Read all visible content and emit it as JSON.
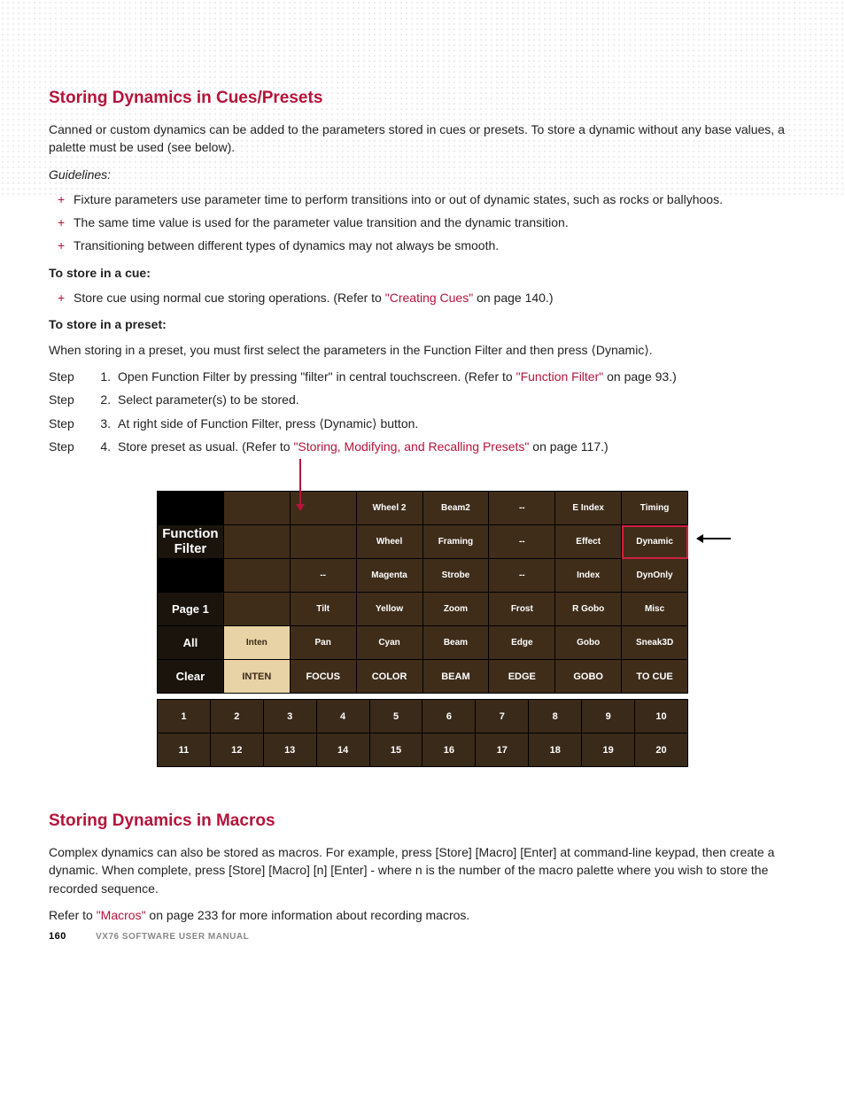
{
  "section1": {
    "title": "Storing Dynamics in Cues/Presets",
    "intro": "Canned or custom dynamics can be added to the parameters stored in cues or presets. To store a dynamic without any base values, a palette must be used (see below).",
    "guidelines_label": "Guidelines:",
    "guidelines": [
      "Fixture parameters use parameter time to perform transitions into or out of dynamic states, such as rocks or ballyhoos.",
      "The same time value is used for the parameter value transition and the dynamic transition.",
      "Transitioning between different types of dynamics may not always be smooth."
    ],
    "store_cue_label": "To store in a cue:",
    "store_cue_item_pre": "Store cue using normal cue storing operations. (Refer to ",
    "store_cue_link": "\"Creating Cues\"",
    "store_cue_item_post": " on page 140.)",
    "store_preset_label": "To store in a preset:",
    "store_preset_intro": "When storing in a preset, you must first select the parameters in the Function Filter and then press ⟨Dynamic⟩.",
    "step_label": "Step",
    "steps": [
      {
        "num": "1.",
        "pre": "Open Function Filter by pressing \"filter\" in central touchscreen. (Refer to ",
        "link": "\"Function Filter\"",
        "post": " on page 93.)"
      },
      {
        "num": "2.",
        "pre": "Select parameter(s) to be stored.",
        "link": "",
        "post": ""
      },
      {
        "num": "3.",
        "pre": "At right side of Function Filter, press ⟨Dynamic⟩ button.",
        "link": "",
        "post": ""
      },
      {
        "num": "4.",
        "pre": "Store preset as usual. (Refer to ",
        "link": "\"Storing, Modifying, and Recalling Presets\"",
        "post": " on page 117.)"
      }
    ]
  },
  "filter_grid": {
    "side": {
      "title": "Function\nFilter",
      "page": "Page 1",
      "all": "All",
      "clear": "Clear"
    },
    "rows": [
      [
        "",
        "",
        "",
        "Wheel 2",
        "Beam2",
        "--",
        "E Index",
        "Timing"
      ],
      [
        "",
        "",
        "",
        "Wheel",
        "Framing",
        "--",
        "Effect",
        "Dynamic"
      ],
      [
        "",
        "",
        "--",
        "Magenta",
        "Strobe",
        "--",
        "Index",
        "DynOnly"
      ],
      [
        "",
        "",
        "Tilt",
        "Yellow",
        "Zoom",
        "Frost",
        "R Gobo",
        "Misc"
      ],
      [
        "",
        "Inten",
        "Pan",
        "Cyan",
        "Beam",
        "Edge",
        "Gobo",
        "Sneak3D"
      ],
      [
        "",
        "INTEN",
        "FOCUS",
        "COLOR",
        "BEAM",
        "EDGE",
        "GOBO",
        "TO CUE"
      ]
    ],
    "nums_row1": [
      "1",
      "2",
      "3",
      "4",
      "5",
      "6",
      "7",
      "8",
      "9",
      "10"
    ],
    "nums_row2": [
      "11",
      "12",
      "13",
      "14",
      "15",
      "16",
      "17",
      "18",
      "19",
      "20"
    ]
  },
  "section2": {
    "title": "Storing Dynamics in Macros",
    "p1": "Complex dynamics can also be stored as macros. For example, press [Store] [Macro] [Enter] at command-line keypad, then create a dynamic. When complete, press [Store] [Macro] [n] [Enter] - where n is the number of the macro palette where you wish to store the recorded sequence.",
    "p2_pre": "Refer to ",
    "p2_link": "\"Macros\"",
    "p2_post": " on page 233 for more information about recording macros."
  },
  "footer": {
    "page": "160",
    "title": "VX76 SOFTWARE USER MANUAL"
  }
}
